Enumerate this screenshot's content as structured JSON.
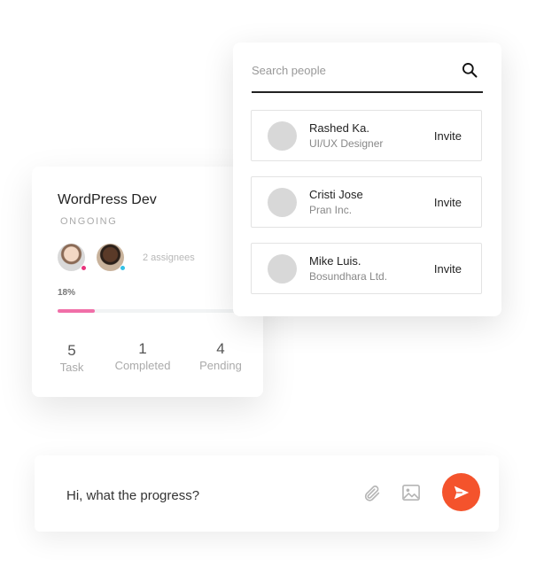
{
  "project": {
    "title": "WordPress Dev",
    "status": "ONGOING",
    "assignees_label": "2 assignees",
    "progress_label": "18%",
    "progress_value": 0.18,
    "progress_color": "#f06fa8",
    "avatar_dot_colors": [
      "#e8337c",
      "#34c1e6"
    ],
    "stats": [
      {
        "value": "5",
        "label": "Task"
      },
      {
        "value": "1",
        "label": "Completed"
      },
      {
        "value": "4",
        "label": "Pending"
      }
    ]
  },
  "people_search": {
    "placeholder": "Search people",
    "value": "",
    "icon": "search-icon",
    "people": [
      {
        "name": "Rashed Ka.",
        "role": "UI/UX Designer",
        "action": "Invite"
      },
      {
        "name": "Cristi Jose",
        "role": "Pran Inc.",
        "action": "Invite"
      },
      {
        "name": "Mike Luis.",
        "role": "Bosundhara Ltd.",
        "action": "Invite"
      }
    ]
  },
  "composer": {
    "message": "Hi, what the progress?",
    "attach_icon": "paperclip-icon",
    "image_icon": "image-icon",
    "send_icon": "send-icon",
    "send_color": "#f4532c"
  }
}
